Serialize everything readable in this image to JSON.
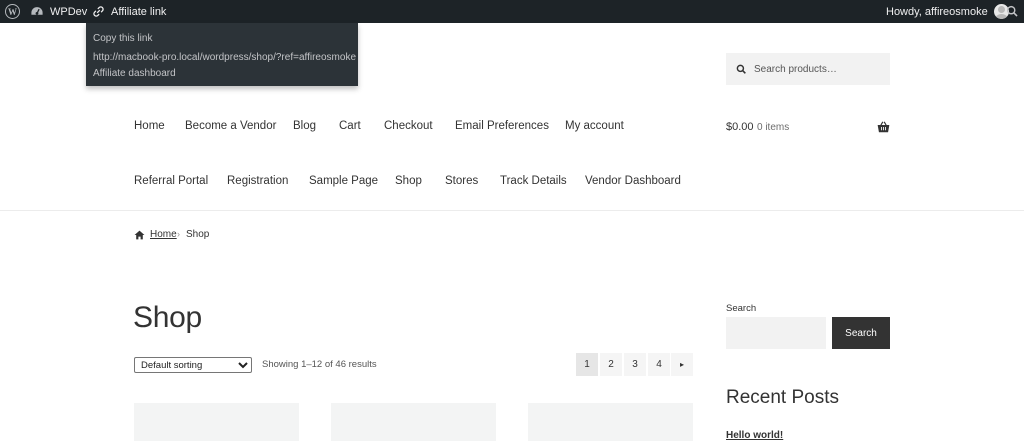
{
  "admin_bar": {
    "site_name": "WPDev",
    "affiliate_link_label": "Affiliate link",
    "greeting": "Howdy, affireosmoke",
    "dropdown": {
      "copy_label": "Copy this link",
      "url": "http://macbook-pro.local/wordpress/shop/?ref=affireosmoke",
      "dashboard_label": "Affiliate dashboard"
    },
    "icons": [
      "wordpress-logo-icon",
      "dashboard-icon",
      "link-icon",
      "avatar",
      "search-icon"
    ]
  },
  "header": {
    "search_placeholder": "Search products…",
    "cart": {
      "amount": "$0.00",
      "items": "0 items"
    }
  },
  "nav": {
    "row1": [
      "Home",
      "Become a Vendor",
      "Blog",
      "Cart",
      "Checkout",
      "Email Preferences",
      "My account"
    ],
    "row2": [
      "Referral Portal",
      "Registration",
      "Sample Page",
      "Shop",
      "Stores",
      "Track Details",
      "Vendor Dashboard"
    ]
  },
  "breadcrumb": {
    "home": "Home",
    "current": "Shop"
  },
  "shop": {
    "title": "Shop",
    "sorting_selected": "Default sorting",
    "result_count": "Showing 1–12 of 46 results",
    "pages": [
      "1",
      "2",
      "3",
      "4"
    ],
    "next_label": "▸"
  },
  "sidebar": {
    "search_label": "Search",
    "search_button": "Search",
    "recent_posts_title": "Recent Posts",
    "posts": [
      "Hello world!"
    ]
  },
  "colors": {
    "admin_bar_bg": "#1d2327",
    "dropdown_bg": "#2c3338",
    "button_bg": "#333333"
  }
}
